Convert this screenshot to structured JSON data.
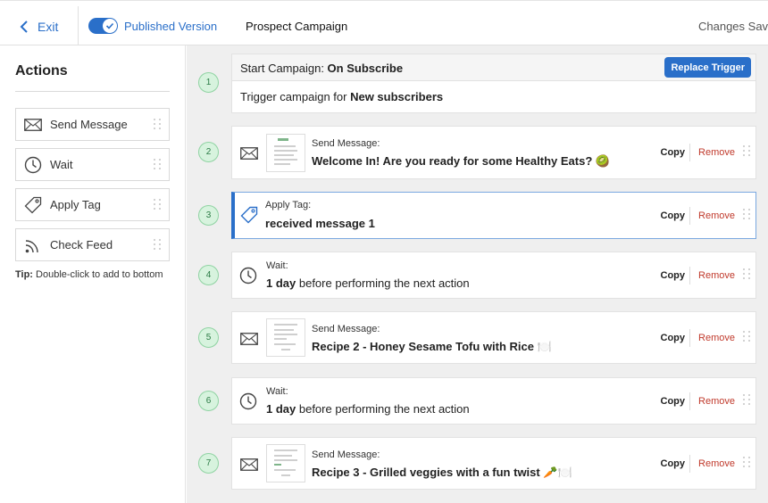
{
  "header": {
    "exit_label": "Exit",
    "published_label": "Published Version",
    "campaign_title": "Prospect Campaign",
    "save_status": "Changes Saved"
  },
  "sidebar": {
    "title": "Actions",
    "items": [
      {
        "label": "Send Message",
        "icon": "envelope-icon"
      },
      {
        "label": "Wait",
        "icon": "clock-icon"
      },
      {
        "label": "Apply Tag",
        "icon": "tag-icon"
      },
      {
        "label": "Check Feed",
        "icon": "rss-icon"
      }
    ],
    "tip_label": "Tip:",
    "tip_text": "Double-click to add to bottom"
  },
  "trigger": {
    "number": "1",
    "head_prefix": "Start Campaign: ",
    "head_value": "On Subscribe",
    "button": "Replace Trigger",
    "body_prefix": "Trigger campaign for ",
    "body_value": "New subscribers"
  },
  "steps": [
    {
      "number": "2",
      "type": "Send Message:",
      "value": "Welcome In! Are you ready for some Healthy Eats? 🥝",
      "icon": "envelope-icon"
    },
    {
      "number": "3",
      "type": "Apply Tag:",
      "value": "received message 1",
      "icon": "tag-icon"
    },
    {
      "number": "4",
      "type": "Wait:",
      "value_bold": "1 day",
      "value_rest": " before performing the next action",
      "icon": "clock-icon"
    },
    {
      "number": "5",
      "type": "Send Message:",
      "value": "Recipe 2 - Honey Sesame Tofu with Rice 🍽️",
      "icon": "envelope-icon"
    },
    {
      "number": "6",
      "type": "Wait:",
      "value_bold": "1 day",
      "value_rest": " before performing the next action",
      "icon": "clock-icon"
    },
    {
      "number": "7",
      "type": "Send Message:",
      "value": "Recipe 3 - Grilled veggies with a fun twist 🥕🍽️",
      "icon": "envelope-icon"
    }
  ],
  "card_actions": {
    "copy": "Copy",
    "remove": "Remove"
  },
  "colors": {
    "accent": "#2a6fc9",
    "remove": "#c0392b",
    "step_badge": "#d7f3de",
    "canvas": "#efefef"
  }
}
